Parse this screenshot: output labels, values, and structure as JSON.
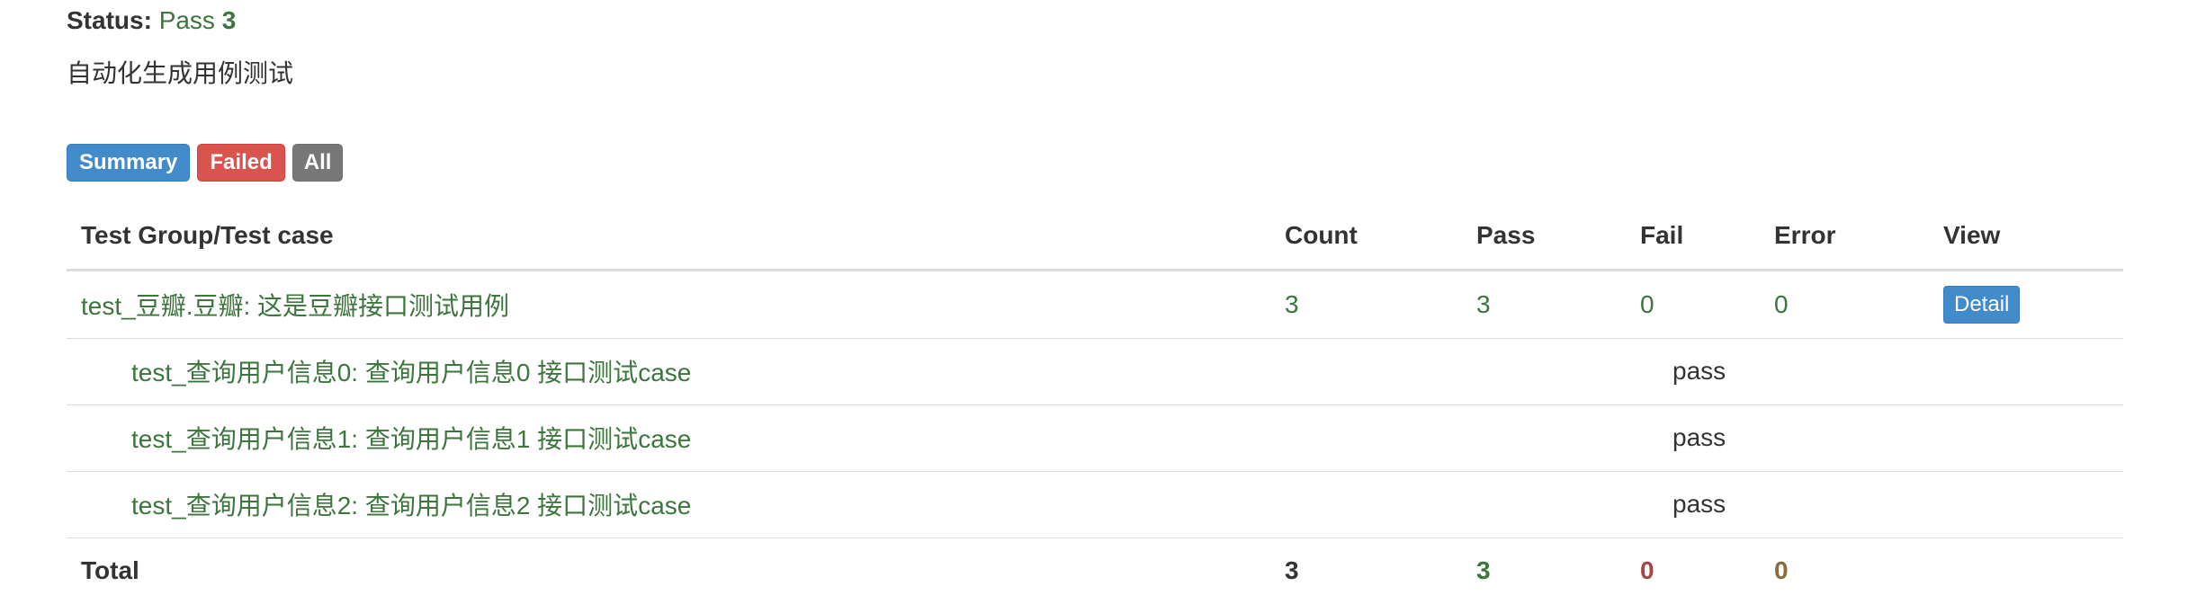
{
  "status": {
    "label": "Status:",
    "result": "Pass",
    "count": "3"
  },
  "description": "自动化生成用例测试",
  "filters": {
    "summary": "Summary",
    "failed": "Failed",
    "all": "All"
  },
  "table": {
    "headers": {
      "name": "Test Group/Test case",
      "count": "Count",
      "pass": "Pass",
      "fail": "Fail",
      "error": "Error",
      "view": "View"
    },
    "group": {
      "name": "test_豆瓣.豆瓣: 这是豆瓣接口测试用例",
      "count": "3",
      "pass": "3",
      "fail": "0",
      "error": "0",
      "view": "Detail"
    },
    "cases": [
      {
        "name": "test_查询用户信息0: 查询用户信息0 接口测试case",
        "status": "pass"
      },
      {
        "name": "test_查询用户信息1: 查询用户信息1 接口测试case",
        "status": "pass"
      },
      {
        "name": "test_查询用户信息2: 查询用户信息2 接口测试case",
        "status": "pass"
      }
    ],
    "total": {
      "label": "Total",
      "count": "3",
      "pass": "3",
      "fail": "0",
      "error": "0"
    }
  },
  "colors": {
    "pass": "#3c763d",
    "fail": "#a94442",
    "error": "#8a6d3b",
    "summary_button": "#428bca",
    "failed_button": "#d9534f",
    "all_button": "#777777"
  }
}
